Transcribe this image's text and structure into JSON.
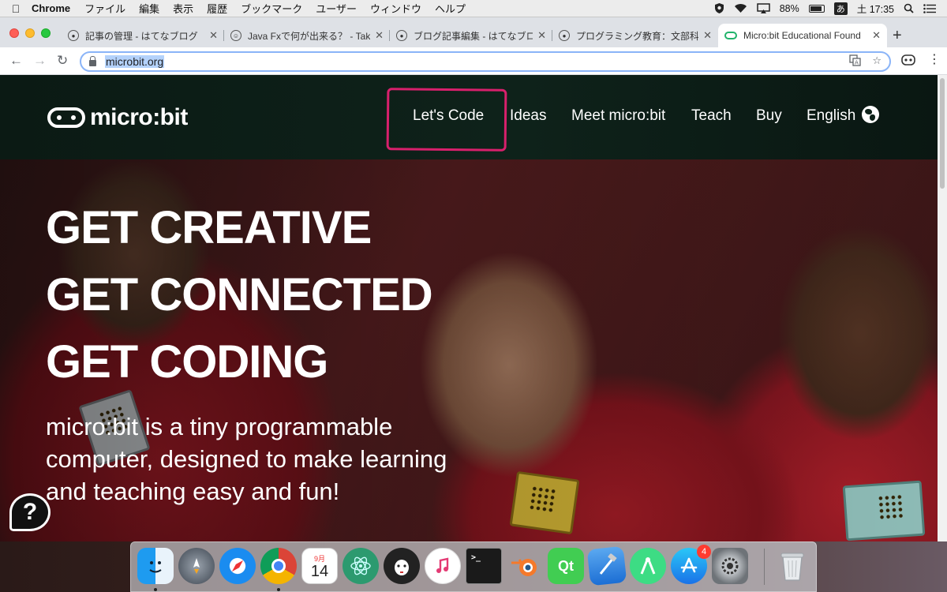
{
  "menubar": {
    "app_name": "Chrome",
    "items": [
      "ファイル",
      "編集",
      "表示",
      "履歴",
      "ブックマーク",
      "ユーザー",
      "ウィンドウ",
      "ヘルプ"
    ],
    "battery": "88%",
    "ime": "あ",
    "clock": "土 17:35"
  },
  "tabs": [
    {
      "title": "記事の管理 - はてなブログ"
    },
    {
      "title": "Java Fxで何が出来る？ - Taku"
    },
    {
      "title": "ブログ記事編集 - はてなブログ"
    },
    {
      "title": "プログラミング教育：文部科学省"
    },
    {
      "title": "Micro:bit Educational Found"
    }
  ],
  "toolbar": {
    "url": "microbit.org"
  },
  "site": {
    "logo_text": "micro:bit",
    "nav": [
      "Let's Code",
      "Ideas",
      "Meet micro:bit",
      "Teach",
      "Buy",
      "English"
    ]
  },
  "hero": {
    "lines": [
      "GET CREATIVE",
      "GET CONNECTED",
      "GET CODING"
    ],
    "subtitle": "micro:bit is a tiny programmable computer, designed to make learning and teaching easy and fun!",
    "help_glyph": "?"
  },
  "dock": {
    "calendar_month": "9月",
    "calendar_day": "14",
    "appstore_badge": "4",
    "apps": [
      "finder-icon",
      "launchpad-icon",
      "safari-icon",
      "chrome-icon",
      "calendar-icon",
      "atom-icon",
      "alpaca-icon",
      "itunes-icon",
      "terminal-icon",
      "blender-icon",
      "qt-creator-icon",
      "xcode-icon",
      "android-studio-icon",
      "app-store-icon",
      "system-preferences-icon",
      "trash-icon"
    ]
  },
  "colors": {
    "header_bg": "#0e221a",
    "highlight": "#d8206c",
    "omnibox_focus": "#8ab4f8"
  }
}
